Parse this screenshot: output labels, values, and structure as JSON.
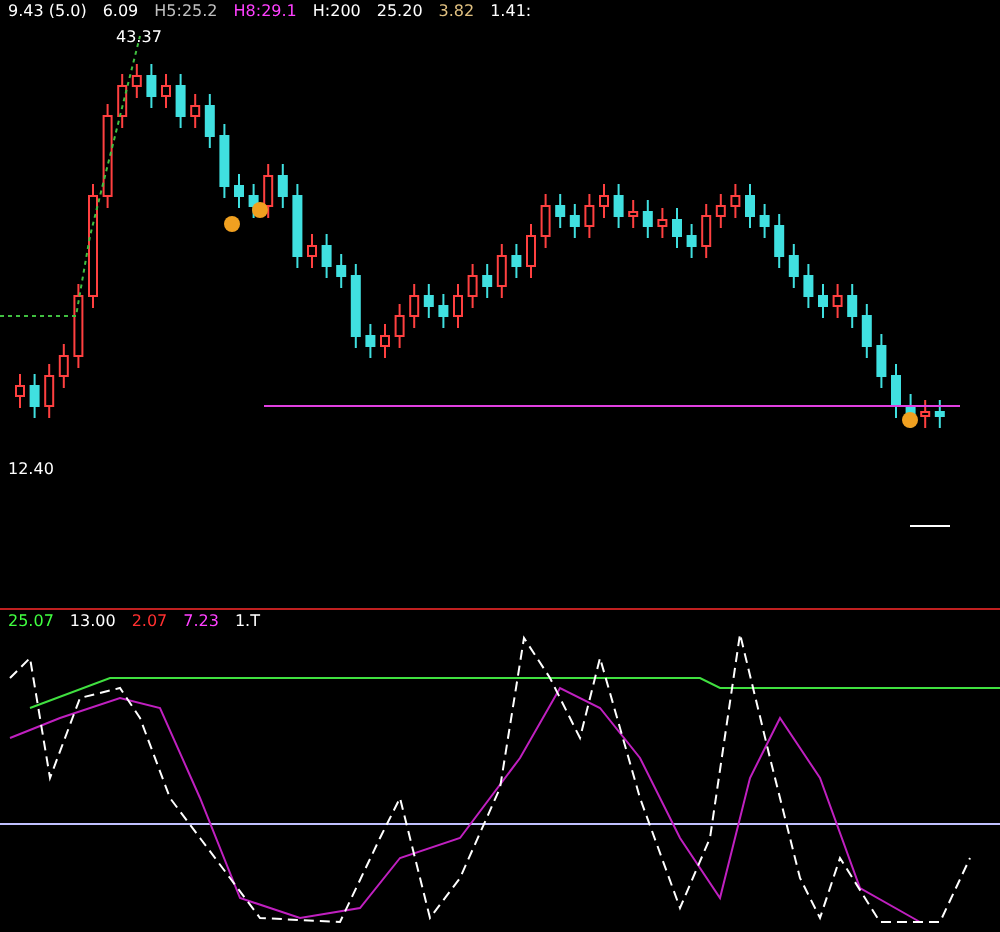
{
  "price_header": [
    {
      "text": "9.43 (5.0)",
      "color": "#ffffff"
    },
    {
      "text": "6.09",
      "color": "#ffffff"
    },
    {
      "text": "H5:25.2",
      "color": "#c0c0c0"
    },
    {
      "text": "H8:29.1",
      "color": "#ff40ff"
    },
    {
      "text": "H:200",
      "color": "#ffffff"
    },
    {
      "text": "25.20",
      "color": "#ffffff"
    },
    {
      "text": "3.82",
      "color": "#e0c080"
    },
    {
      "text": "1.41:",
      "color": "#ffffff"
    }
  ],
  "high_label": "43.37",
  "low_label": "12.40",
  "indicator_header": [
    {
      "text": "25.07",
      "color": "#40ff40"
    },
    {
      "text": "13.00",
      "color": "#ffffff"
    },
    {
      "text": "2.07",
      "color": "#ff3030"
    },
    {
      "text": "7.23",
      "color": "#ff40ff"
    },
    {
      "text": "1.T",
      "color": "#ffffff"
    }
  ]
}
